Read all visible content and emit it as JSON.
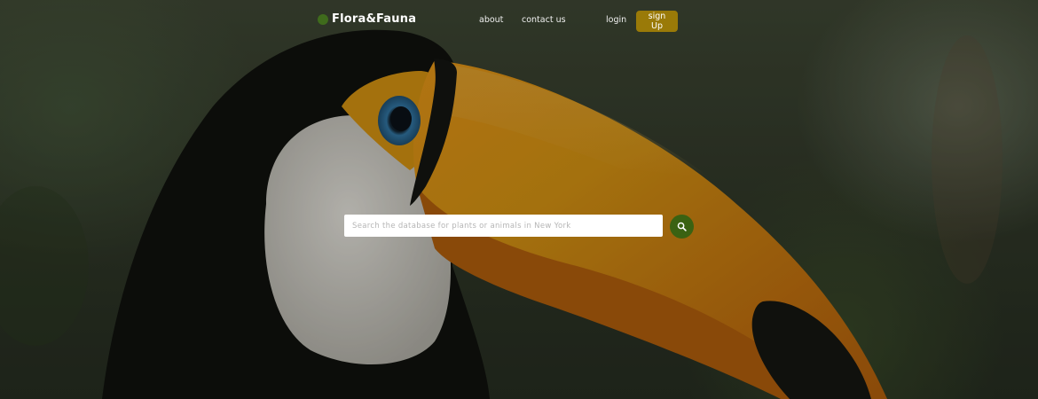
{
  "brand": {
    "name": "Flora&Fauna"
  },
  "nav": {
    "about": "about",
    "contact": "contact us",
    "login": "login",
    "signup": "sign Up"
  },
  "search": {
    "placeholder": "Search the database for plants or animals in New York",
    "value": ""
  },
  "icons": {
    "brand_mark": "leaf-dot-icon",
    "search": "search-icon"
  },
  "colors": {
    "signup_button": "#9a7a08",
    "search_button": "#3a6212",
    "brand_mark": "#3f6b1c"
  }
}
